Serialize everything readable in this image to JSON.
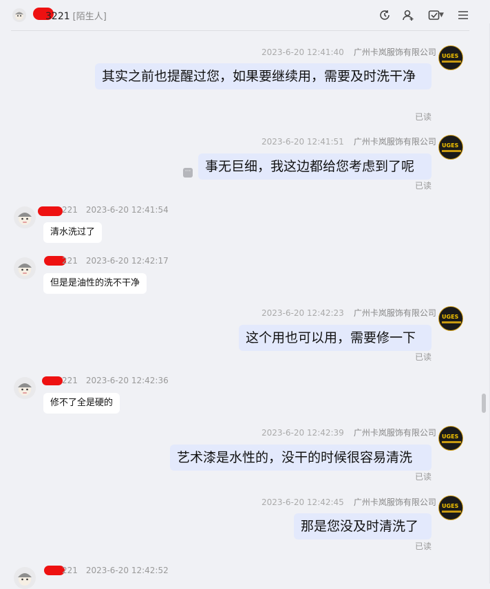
{
  "header": {
    "name": "3221",
    "tag": "[陌生人]",
    "icons": [
      "refresh-icon",
      "user-add-icon",
      "task-icon",
      "menu-icon"
    ]
  },
  "messages": [
    {
      "dir": "out",
      "time": "2023-6-20 12:41:40",
      "sender": "广州卡岚服饰有限公司",
      "text": "其实之前也提醒过您，如果要继续用，需要及时洗干净",
      "status": "已读"
    },
    {
      "dir": "out",
      "time": "2023-6-20 12:41:51",
      "sender": "广州卡岚服饰有限公司",
      "text": "事无巨细，我这边都给您考虑到了呢",
      "status": "已读"
    },
    {
      "dir": "in",
      "name": "221",
      "time": "2023-6-20 12:41:54",
      "text": "清水洗过了"
    },
    {
      "dir": "in",
      "name": "221",
      "time": "2023-6-20 12:42:17",
      "text": "但是是油性的洗不干净"
    },
    {
      "dir": "out",
      "time": "2023-6-20 12:42:23",
      "sender": "广州卡岚服饰有限公司",
      "text": "这个用也可以用，需要修一下",
      "status": "已读"
    },
    {
      "dir": "in",
      "name": "221",
      "time": "2023-6-20 12:42:36",
      "text": "修不了全是硬的"
    },
    {
      "dir": "out",
      "time": "2023-6-20 12:42:39",
      "sender": "广州卡岚服饰有限公司",
      "text": "艺术漆是水性的，没干的时候很容易清洗",
      "status": "已读"
    },
    {
      "dir": "out",
      "time": "2023-6-20 12:42:45",
      "sender": "广州卡岚服饰有限公司",
      "text": "那是您没及时清洗了",
      "status": "已读"
    },
    {
      "dir": "in",
      "name": "221",
      "time": "2023-6-20 12:42:52",
      "text": ""
    }
  ],
  "avatar_text": "UGES"
}
